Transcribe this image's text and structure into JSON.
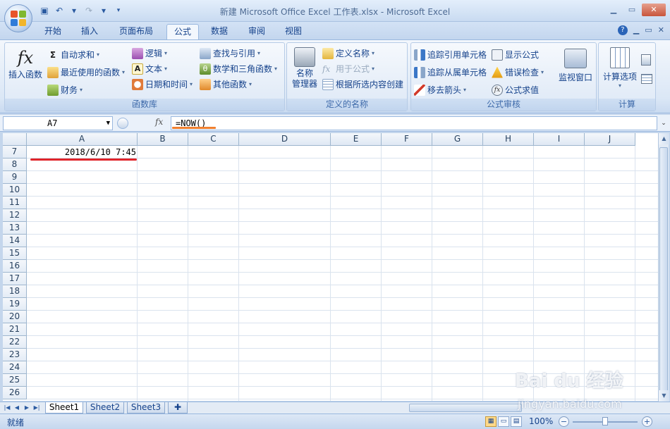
{
  "window": {
    "title": "新建 Microsoft Office Excel 工作表.xlsx - Microsoft Excel"
  },
  "tabs": [
    {
      "label": "开始",
      "active": false
    },
    {
      "label": "插入",
      "active": false
    },
    {
      "label": "页面布局",
      "active": false
    },
    {
      "label": "公式",
      "active": true
    },
    {
      "label": "数据",
      "active": false
    },
    {
      "label": "审阅",
      "active": false
    },
    {
      "label": "视图",
      "active": false
    }
  ],
  "ribbon": {
    "function_library": {
      "label": "函数库",
      "insert_function": "插入函数",
      "autosum": "自动求和",
      "recent": "最近使用的函数",
      "financial": "财务",
      "logical": "逻辑",
      "text": "文本",
      "datetime": "日期和时间",
      "lookup": "查找与引用",
      "math": "数学和三角函数",
      "more": "其他函数"
    },
    "defined_names": {
      "label": "定义的名称",
      "name_manager": "名称\n管理器",
      "define_name": "定义名称",
      "use_in_formula": "用于公式",
      "create_from_selection": "根据所选内容创建"
    },
    "formula_auditing": {
      "label": "公式审核",
      "trace_precedents": "追踪引用单元格",
      "trace_dependents": "追踪从属单元格",
      "remove_arrows": "移去箭头",
      "show_formulas": "显示公式",
      "error_checking": "错误检查",
      "evaluate_formula": "公式求值",
      "watch_window": "监视窗口"
    },
    "calculation": {
      "label": "计算",
      "calc_options": "计算选项"
    }
  },
  "formula_bar": {
    "name_box": "A7",
    "fx": "fx",
    "formula": "=NOW()"
  },
  "grid": {
    "columns": [
      "A",
      "B",
      "C",
      "D",
      "E",
      "F",
      "G",
      "H",
      "I",
      "J"
    ],
    "rows": [
      "7",
      "8",
      "9",
      "10",
      "11",
      "12",
      "13",
      "14",
      "15",
      "16",
      "17",
      "18",
      "19",
      "20",
      "21",
      "22",
      "23",
      "24",
      "25",
      "26"
    ],
    "cell_A7": "2018/6/10 7:45"
  },
  "sheets": [
    {
      "label": "Sheet1",
      "active": true
    },
    {
      "label": "Sheet2",
      "active": false
    },
    {
      "label": "Sheet3",
      "active": false
    }
  ],
  "status": {
    "ready": "就绪",
    "zoom": "100%"
  },
  "watermark": {
    "main": "Bai du 经验",
    "sub": "jingyan.baidu.com"
  },
  "colors": {
    "accent_underline": "#e0242a",
    "formula_underline": "#f08030"
  }
}
